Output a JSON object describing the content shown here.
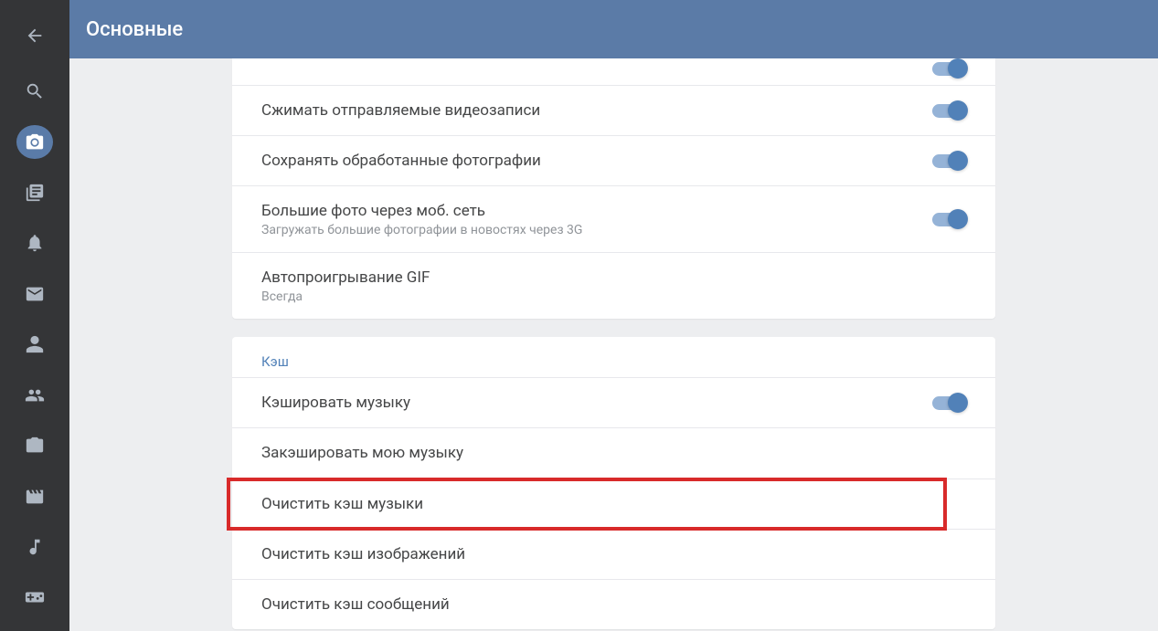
{
  "header": {
    "title": "Основные"
  },
  "colors": {
    "accent": "#5181b8",
    "headerBg": "#5b7ba7",
    "sidebarBg": "#343537",
    "highlight": "#d82a2a"
  },
  "group1": {
    "rows": [
      {
        "title": "",
        "toggle": true
      },
      {
        "title": "Сжимать отправляемые видеозаписи",
        "toggle": true
      },
      {
        "title": "Сохранять обработанные фотографии",
        "toggle": true
      },
      {
        "title": "Большие фото через моб. сеть",
        "subtitle": "Загружать большие фотографии в новостях через 3G",
        "toggle": true
      },
      {
        "title": "Автопроигрывание GIF",
        "subtitle": "Всегда"
      }
    ]
  },
  "group2": {
    "header": "Кэш",
    "rows": [
      {
        "title": "Кэшировать музыку",
        "toggle": true
      },
      {
        "title": "Закэшировать мою музыку"
      },
      {
        "title": "Очистить кэш музыки",
        "highlighted": true
      },
      {
        "title": "Очистить кэш изображений"
      },
      {
        "title": "Очистить кэш сообщений"
      }
    ]
  },
  "sidebar": {
    "items": [
      "back",
      "search",
      "camera",
      "news",
      "notifications",
      "messages",
      "profile",
      "groups",
      "photos",
      "videos",
      "music",
      "games"
    ]
  }
}
